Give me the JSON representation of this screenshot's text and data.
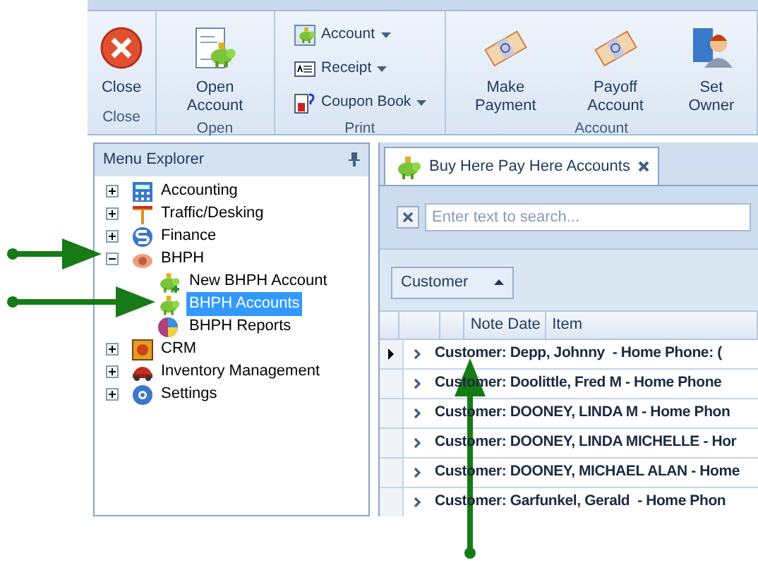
{
  "ribbon": {
    "groups": [
      {
        "label": "Close",
        "buttons": [
          {
            "label": "Close",
            "kind": "large",
            "dropdown": false
          }
        ]
      },
      {
        "label": "Open",
        "buttons": [
          {
            "label": "Open Account",
            "kind": "large",
            "dropdown": false
          }
        ]
      },
      {
        "label": "Print",
        "buttons": [
          {
            "label": "Account",
            "kind": "small",
            "dropdown": true
          },
          {
            "label": "Receipt",
            "kind": "small",
            "dropdown": true
          },
          {
            "label": "Coupon Book",
            "kind": "small",
            "dropdown": true
          }
        ]
      },
      {
        "label": "Account",
        "buttons": [
          {
            "label": "Make Payment",
            "kind": "large",
            "dropdown": false
          },
          {
            "label": "Payoff Account",
            "kind": "large",
            "dropdown": false
          },
          {
            "label": "Set Owner",
            "kind": "large",
            "dropdown": false
          }
        ]
      }
    ]
  },
  "menu_explorer": {
    "title": "Menu Explorer",
    "items": [
      {
        "label": "Accounting",
        "expanded": false,
        "selected": false
      },
      {
        "label": "Traffic/Desking",
        "expanded": false,
        "selected": false
      },
      {
        "label": "Finance",
        "expanded": false,
        "selected": false
      },
      {
        "label": "BHPH",
        "expanded": true,
        "selected": false,
        "children": [
          {
            "label": "New BHPH Account",
            "selected": false
          },
          {
            "label": "BHPH Accounts",
            "selected": true
          },
          {
            "label": "BHPH Reports",
            "selected": false
          }
        ]
      },
      {
        "label": "CRM",
        "expanded": false,
        "selected": false
      },
      {
        "label": "Inventory Management",
        "expanded": false,
        "selected": false
      },
      {
        "label": "Settings",
        "expanded": false,
        "selected": false
      }
    ]
  },
  "document_tab": {
    "title": "Buy Here Pay Here Accounts"
  },
  "search": {
    "placeholder": "Enter text to search..."
  },
  "group_panel": {
    "column": "Customer"
  },
  "grid": {
    "columns": [
      "Note Date",
      "Item"
    ],
    "rows": [
      {
        "text": "Customer: Depp, Johnny  - Home Phone: (",
        "current": true
      },
      {
        "text": "Customer: Doolittle, Fred M - Home Phone",
        "current": false
      },
      {
        "text": "Customer: DOONEY, LINDA M - Home Phon",
        "current": false
      },
      {
        "text": "Customer: DOONEY, LINDA MICHELLE - Hor",
        "current": false
      },
      {
        "text": "Customer: DOONEY, MICHAEL ALAN - Home",
        "current": false
      },
      {
        "text": "Customer: Garfunkel, Gerald  - Home Phon",
        "current": false
      }
    ]
  }
}
